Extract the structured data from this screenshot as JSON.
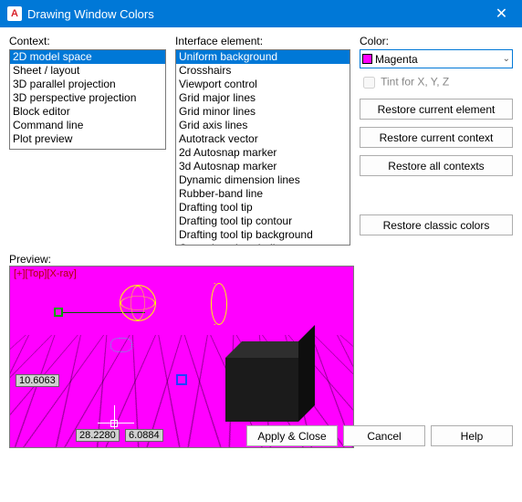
{
  "window": {
    "title": "Drawing Window Colors",
    "app_icon_letter": "A"
  },
  "labels": {
    "context": "Context:",
    "interface_element": "Interface element:",
    "color": "Color:",
    "tint": "Tint for X, Y, Z",
    "preview": "Preview:"
  },
  "context_list": [
    "2D model space",
    "Sheet / layout",
    "3D parallel projection",
    "3D perspective projection",
    "Block editor",
    "Command line",
    "Plot preview"
  ],
  "element_list": [
    "Uniform background",
    "Crosshairs",
    "Viewport control",
    "Grid major lines",
    "Grid minor lines",
    "Grid axis lines",
    "Autotrack vector",
    "2d Autosnap marker",
    "3d Autosnap marker",
    "Dynamic dimension lines",
    "Rubber-band line",
    "Drafting tool tip",
    "Drafting tool tip contour",
    "Drafting tool tip background",
    "Control vertices hull"
  ],
  "color_select": {
    "value": "Magenta"
  },
  "buttons": {
    "restore_element": "Restore current element",
    "restore_context": "Restore current context",
    "restore_all": "Restore all contexts",
    "restore_classic": "Restore classic colors",
    "apply_close": "Apply & Close",
    "cancel": "Cancel",
    "help": "Help"
  },
  "preview": {
    "overlay": "[+][Top][X-ray]",
    "coord1": "10.6063",
    "coord2": "28.2280",
    "coord3": "6.0884"
  }
}
